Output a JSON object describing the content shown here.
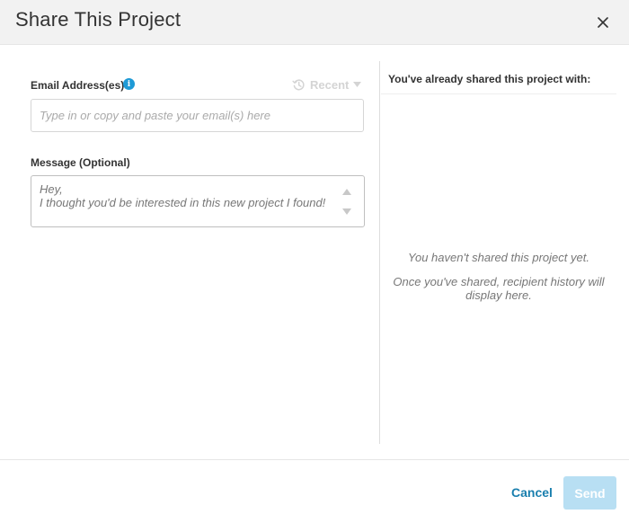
{
  "dialog": {
    "title": "Share This Project"
  },
  "form": {
    "email_label": "Email Address(es)",
    "email_placeholder": "Type in or copy and paste your email(s) here",
    "recent_label": "Recent",
    "message_label": "Message (Optional)",
    "message_text": "Hey,\nI thought you'd be interested in this new project I found!"
  },
  "history": {
    "heading": "You've already shared this project with:",
    "empty_title": "You haven't shared this project yet.",
    "empty_description": "Once you've shared, recipient history will display here."
  },
  "footer": {
    "cancel_label": "Cancel",
    "send_label": "Send"
  },
  "icons": {
    "info": "i"
  },
  "colors": {
    "accent": "#1a7fae",
    "info": "#1e9ad6",
    "send_disabled": "#b8dff3"
  }
}
